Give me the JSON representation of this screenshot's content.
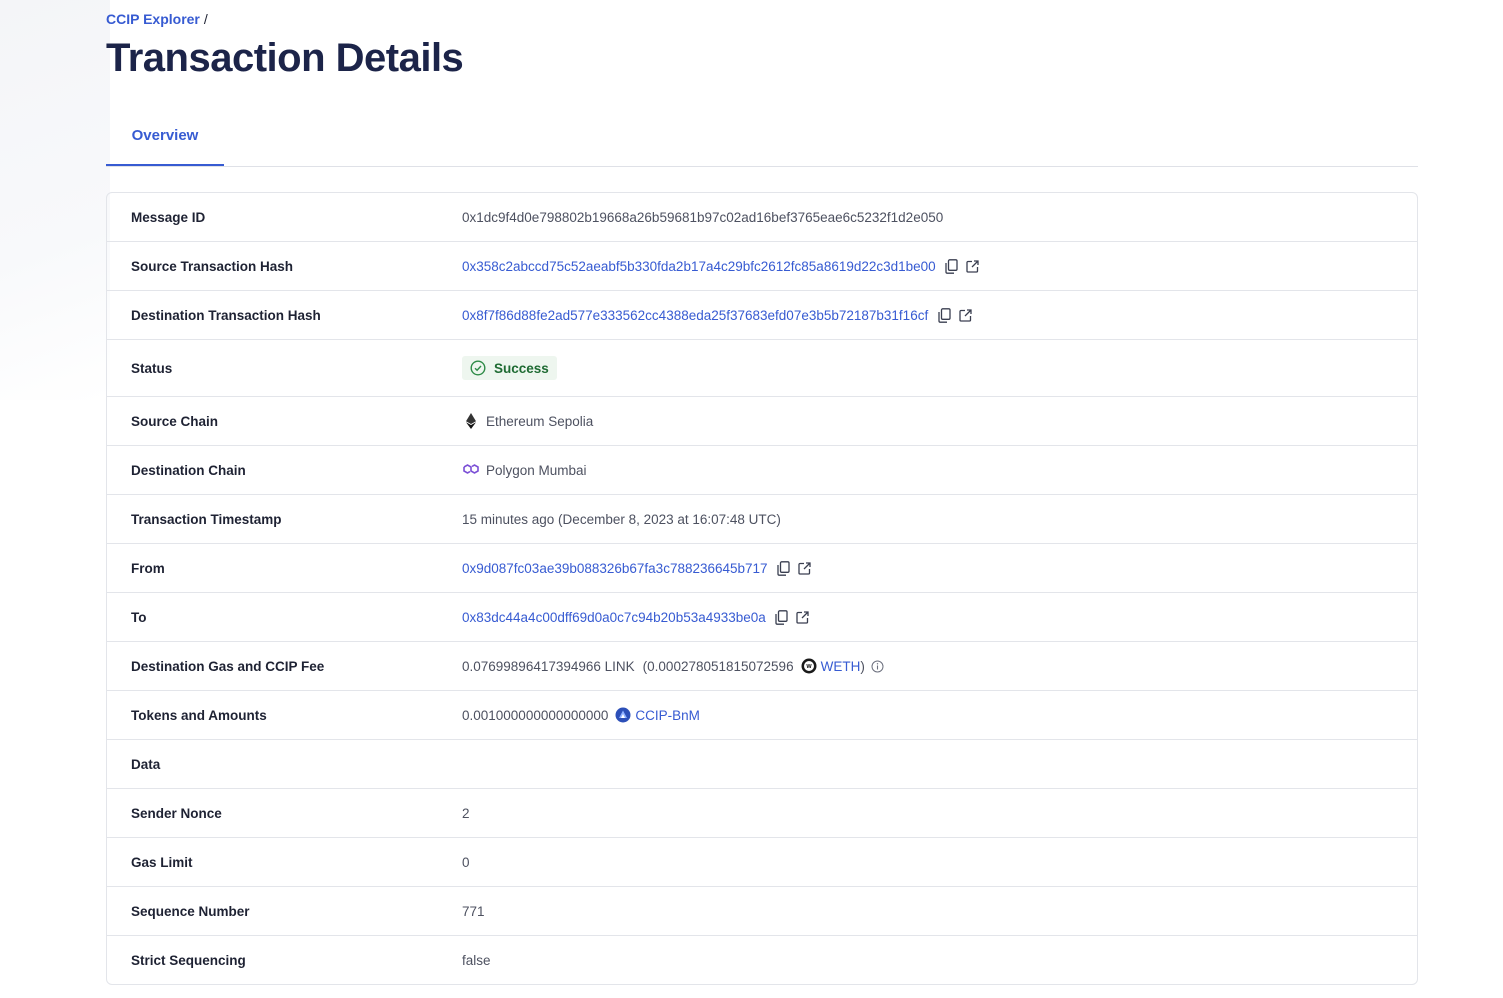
{
  "breadcrumb": {
    "root": "CCIP Explorer",
    "separator": "/"
  },
  "page_title": "Transaction Details",
  "tabs": [
    {
      "label": "Overview"
    }
  ],
  "details": {
    "message_id": {
      "label": "Message ID",
      "value": "0x1dc9f4d0e798802b19668a26b59681b97c02ad16bef3765eae6c5232f1d2e050"
    },
    "source_tx_hash": {
      "label": "Source Transaction Hash",
      "value": "0x358c2abccd75c52aeabf5b330fda2b17a4c29bfc2612fc85a8619d22c3d1be00"
    },
    "dest_tx_hash": {
      "label": "Destination Transaction Hash",
      "value": "0x8f7f86d88fe2ad577e333562cc4388eda25f37683efd07e3b5b72187b31f16cf"
    },
    "status": {
      "label": "Status",
      "value": "Success"
    },
    "source_chain": {
      "label": "Source Chain",
      "value": "Ethereum Sepolia"
    },
    "dest_chain": {
      "label": "Destination Chain",
      "value": "Polygon Mumbai"
    },
    "timestamp": {
      "label": "Transaction Timestamp",
      "value": "15 minutes ago (December 8, 2023 at 16:07:48 UTC)"
    },
    "from": {
      "label": "From",
      "value": "0x9d087fc03ae39b088326b67fa3c788236645b717"
    },
    "to": {
      "label": "To",
      "value": "0x83dc44a4c00dff69d0a0c7c94b20b53a4933be0a"
    },
    "fee": {
      "label": "Destination Gas and CCIP Fee",
      "amount": "0.07699896417394966 LINK",
      "paren_open": "(0.000278051815072596",
      "token": "WETH",
      "paren_close": ")"
    },
    "tokens": {
      "label": "Tokens and Amounts",
      "amount": "0.001000000000000000",
      "token": "CCIP-BnM"
    },
    "data": {
      "label": "Data",
      "value": ""
    },
    "sender_nonce": {
      "label": "Sender Nonce",
      "value": "2"
    },
    "gas_limit": {
      "label": "Gas Limit",
      "value": "0"
    },
    "sequence_number": {
      "label": "Sequence Number",
      "value": "771"
    },
    "strict_sequencing": {
      "label": "Strict Sequencing",
      "value": "false"
    }
  },
  "icons": {
    "copy": "copy-icon",
    "external": "external-link-icon",
    "status": "check-circle-icon",
    "ethereum": "ethereum-icon",
    "polygon": "polygon-icon",
    "weth": "weth-token-icon",
    "ccip_bnm": "ccip-bnm-token-icon",
    "info": "info-icon"
  },
  "colors": {
    "link": "#375bd2",
    "title": "#1c2449",
    "success_bg": "#eef6ef",
    "success_text": "#1f6b33"
  }
}
